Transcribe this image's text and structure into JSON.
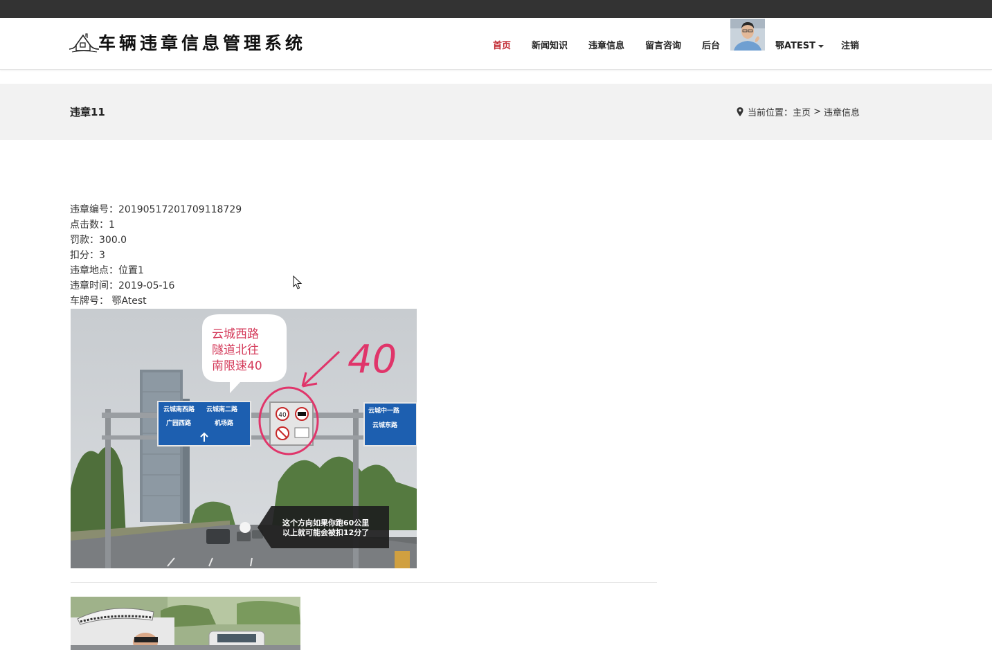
{
  "site": {
    "title": "车辆违章信息管理系统"
  },
  "nav": {
    "items": [
      {
        "label": "首页",
        "active": true
      },
      {
        "label": "新闻知识"
      },
      {
        "label": "违章信息"
      },
      {
        "label": "留言咨询"
      },
      {
        "label": "后台"
      }
    ],
    "user_label": "鄂ATEST",
    "logout_label": "注销",
    "accent_color": "#c0262e"
  },
  "page": {
    "title": "违章11",
    "breadcrumb": {
      "prefix": "当前位置：",
      "home": "主页",
      "separator": ">",
      "current": "违章信息"
    }
  },
  "details": [
    {
      "label": "违章编号：",
      "value": "20190517201709118729"
    },
    {
      "label": "点击数：",
      "value": "1"
    },
    {
      "label": "罚款：",
      "value": "300.0"
    },
    {
      "label": "扣分：",
      "value": "3"
    },
    {
      "label": "违章地点：",
      "value": "位置1"
    },
    {
      "label": "违章时间：",
      "value": "2019-05-16"
    },
    {
      "label": "车牌号：",
      "value": " 鄂Atest"
    }
  ],
  "image": {
    "bubble_lines": [
      "云城西路",
      "隧道北往",
      "南限速40"
    ],
    "handwritten": "40",
    "caption_lines": [
      "这个方向如果你跑60公里",
      "以上就可能会被扣12分了"
    ],
    "sign_left": {
      "col1": [
        "云城南西路",
        "广园西路"
      ],
      "col2": [
        "云城南二路",
        "机场路"
      ]
    },
    "sign_right": [
      "云城中一路",
      "云城东路"
    ],
    "limit_number": "40"
  }
}
